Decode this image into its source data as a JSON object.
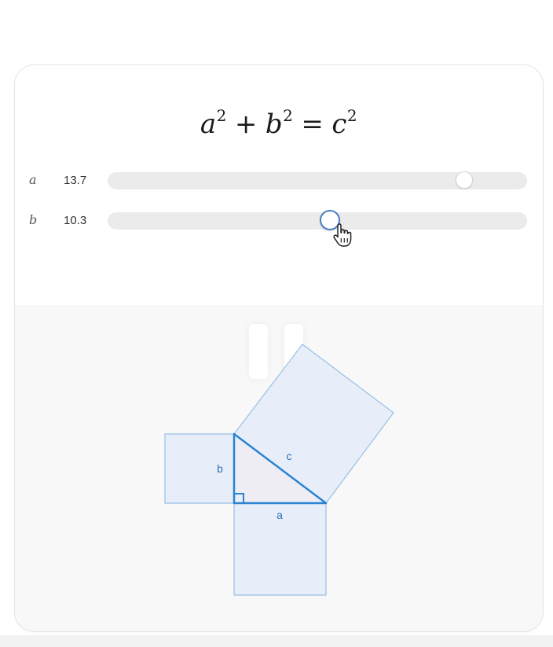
{
  "equation": {
    "a": "a",
    "b": "b",
    "c": "c",
    "exponent": "2",
    "plus": "+",
    "equals": "="
  },
  "sliders": {
    "a": {
      "label": "a",
      "value": "13.7",
      "fraction": 0.85
    },
    "b": {
      "label": "b",
      "value": "10.3",
      "fraction": 0.53
    }
  },
  "figure": {
    "labels": {
      "a": "a",
      "b": "b",
      "c": "c"
    },
    "colors": {
      "edge": "#2a83d3",
      "square_fill": "#e8eef9",
      "square_stroke": "#97bfe6",
      "triangle_fill": "#eeedf3"
    }
  },
  "icons": {
    "cursor": "hand-pointer-icon",
    "pause": "pause-icon"
  }
}
